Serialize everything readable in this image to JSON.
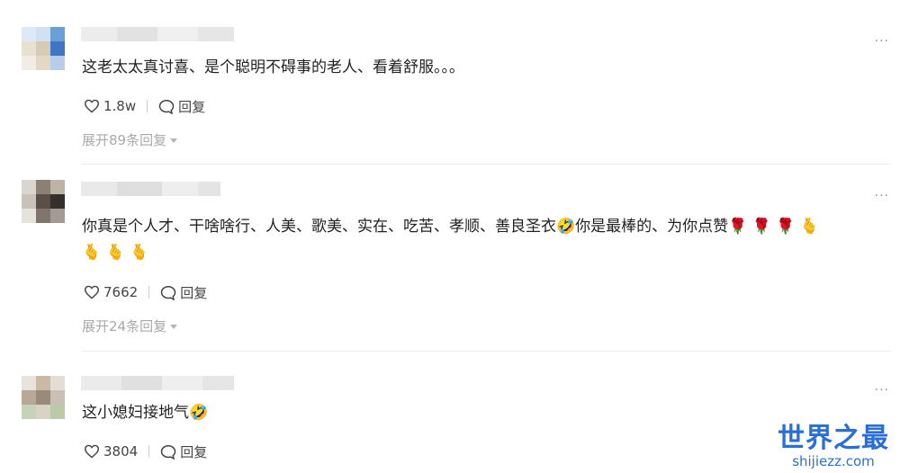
{
  "comments": [
    {
      "text": "这老太太真讨喜、是个聪明不碍事的老人、看着舒服。。。",
      "likes": "1.8w",
      "reply_label": "回复",
      "expand_label": "展开89条回复",
      "more": "···"
    },
    {
      "text": "你真是个人才、干啥啥行、人美、歌美、实在、吃苦、孝顺、善良圣衣🤣你是最棒的、为你点赞🌹 🌹 🌹 🫰",
      "text_line2": "🫰 🫰 🫰",
      "likes": "7662",
      "reply_label": "回复",
      "expand_label": "展开24条回复",
      "more": "···"
    },
    {
      "text": "这小媳妇接地气🤣",
      "likes": "3804",
      "reply_label": "回复",
      "more": "···"
    }
  ],
  "watermark": {
    "title": "世界之最",
    "url": "shijiezz.com"
  },
  "colors": {
    "text": "#222222",
    "muted": "#a9a9a9",
    "watermark": "#2a6fd6"
  }
}
